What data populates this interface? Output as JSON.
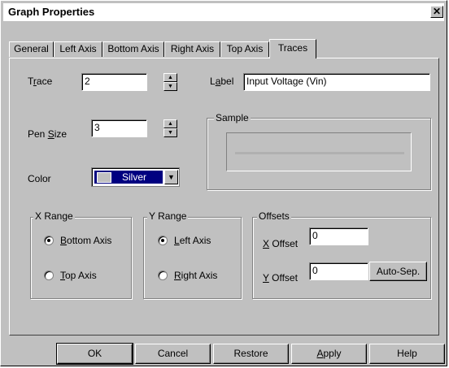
{
  "window": {
    "title": "Graph Properties",
    "close_glyph": "✕"
  },
  "tabs": [
    "General",
    "Left Axis",
    "Bottom Axis",
    "Right Axis",
    "Top Axis",
    "Traces"
  ],
  "active_tab": "Traces",
  "trace": {
    "label_pre": "T",
    "label_u": "r",
    "label_post": "ace",
    "value": "2"
  },
  "label": {
    "label_pre": "L",
    "label_u": "a",
    "label_post": "bel",
    "value": "Input Voltage (Vin)"
  },
  "pen_size": {
    "label_pre": "Pen ",
    "label_u": "S",
    "label_post": "ize",
    "value": "3"
  },
  "color": {
    "label": "Color",
    "value": "Silver",
    "swatch": "#c0c0c0"
  },
  "sample": {
    "legend": "Sample",
    "line_color": "#c0c0c0"
  },
  "x_range": {
    "legend": "X Range",
    "options": [
      {
        "pre": "",
        "u": "B",
        "post": "ottom Axis",
        "selected": true
      },
      {
        "pre": "",
        "u": "T",
        "post": "op Axis",
        "selected": false
      }
    ]
  },
  "y_range": {
    "legend": "Y Range",
    "options": [
      {
        "pre": "",
        "u": "L",
        "post": "eft Axis",
        "selected": true
      },
      {
        "pre": "",
        "u": "R",
        "post": "ight Axis",
        "selected": false
      }
    ]
  },
  "offsets": {
    "legend": "Offsets",
    "x": {
      "pre": "",
      "u": "X",
      "post": " Offset",
      "value": "0"
    },
    "y": {
      "pre": "",
      "u": "Y",
      "post": " Offset",
      "value": "0"
    },
    "auto_sep": "Auto-Sep."
  },
  "buttons": {
    "ok": "OK",
    "cancel": "Cancel",
    "restore": "Restore",
    "apply_pre": "",
    "apply_u": "A",
    "apply_post": "pply",
    "help": "Help"
  }
}
